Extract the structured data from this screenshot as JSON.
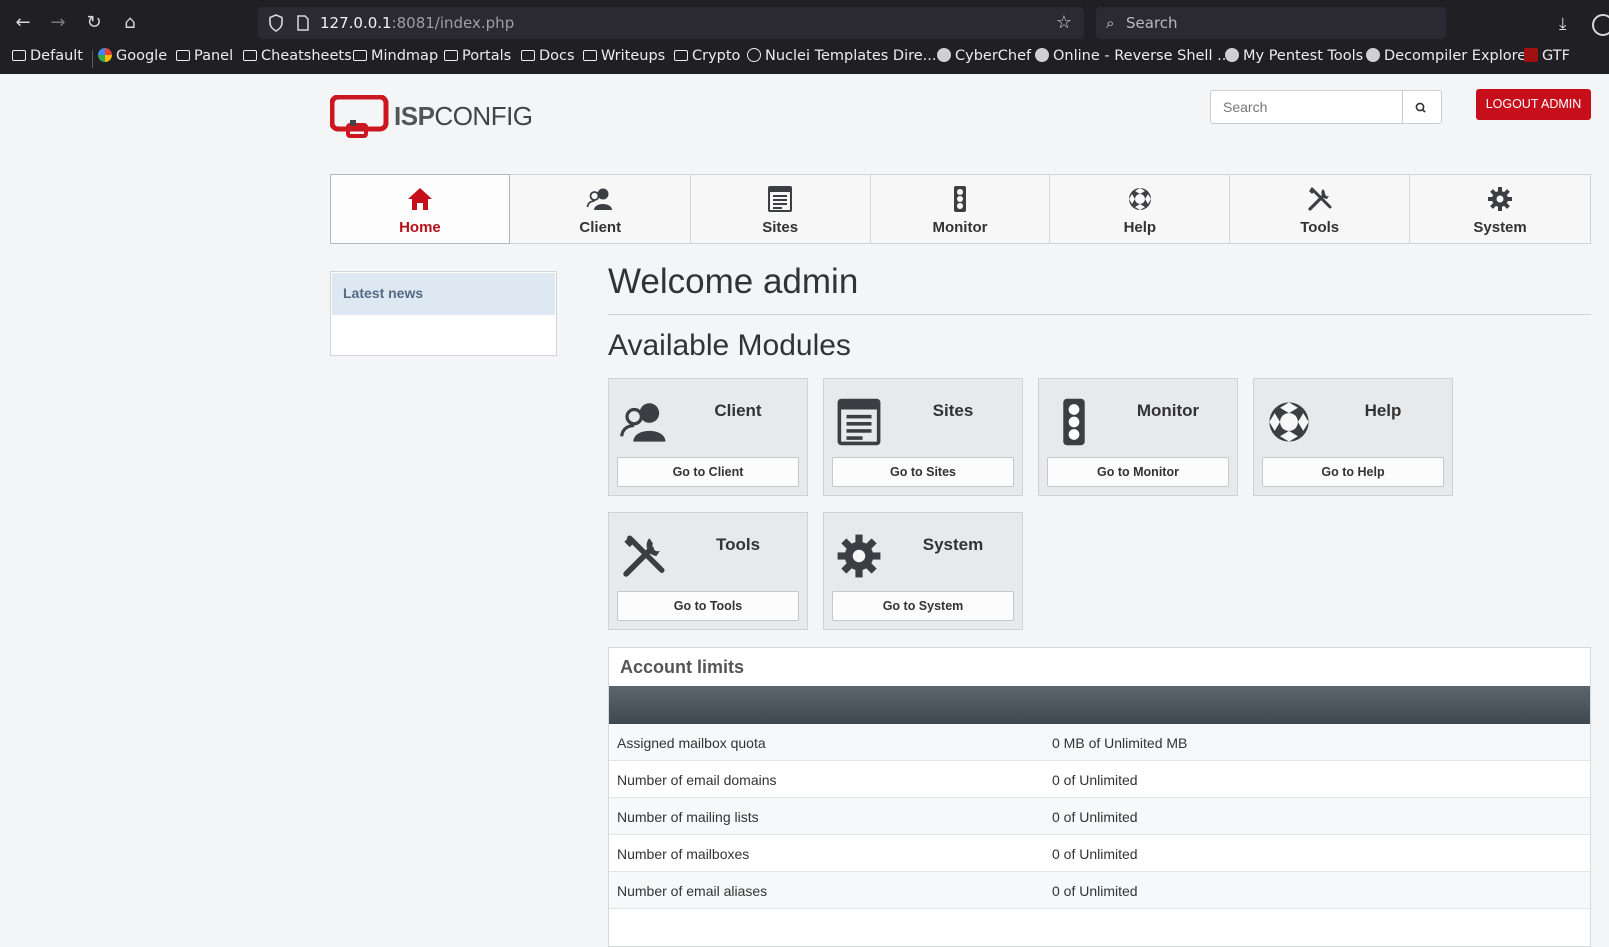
{
  "browser": {
    "url_host": "127.0.0.1",
    "url_rest": ":8081/index.php",
    "search_placeholder": "Search",
    "bookmarks": [
      {
        "label": "Default",
        "icon": "folder-icon"
      },
      {
        "label": "Google",
        "icon": "google-icon"
      },
      {
        "label": "Panel",
        "icon": "folder-icon"
      },
      {
        "label": "Cheatsheets",
        "icon": "folder-icon"
      },
      {
        "label": "Mindmap",
        "icon": "folder-icon"
      },
      {
        "label": "Portals",
        "icon": "folder-icon"
      },
      {
        "label": "Docs",
        "icon": "folder-icon"
      },
      {
        "label": "Writeups",
        "icon": "folder-icon"
      },
      {
        "label": "Crypto",
        "icon": "folder-icon"
      },
      {
        "label": "Nuclei Templates Dire...",
        "icon": "globe-icon"
      },
      {
        "label": "CyberChef",
        "icon": "chef-icon"
      },
      {
        "label": "Online - Reverse Shell ...",
        "icon": "skull-icon"
      },
      {
        "label": "My Pentest Tools",
        "icon": "shield-icon"
      },
      {
        "label": "Decompiler Explorer",
        "icon": "dogbolt-icon"
      },
      {
        "label": "GTF",
        "icon": "gtfo-icon"
      }
    ]
  },
  "header": {
    "logo_bold": "ISP",
    "logo_rest": "CONFIG",
    "search_placeholder": "Search",
    "logout_label": "LOGOUT ADMIN"
  },
  "tabs": [
    {
      "label": "Home",
      "icon": "home-icon",
      "active": true
    },
    {
      "label": "Client",
      "icon": "client-icon"
    },
    {
      "label": "Sites",
      "icon": "sites-icon"
    },
    {
      "label": "Monitor",
      "icon": "monitor-icon"
    },
    {
      "label": "Help",
      "icon": "help-icon"
    },
    {
      "label": "Tools",
      "icon": "tools-icon"
    },
    {
      "label": "System",
      "icon": "system-icon"
    }
  ],
  "sidebar": {
    "news_title": "Latest news"
  },
  "main": {
    "welcome": "Welcome admin",
    "modules_title": "Available Modules",
    "modules": [
      {
        "name": "Client",
        "button": "Go to Client",
        "icon": "client-icon"
      },
      {
        "name": "Sites",
        "button": "Go to Sites",
        "icon": "sites-icon"
      },
      {
        "name": "Monitor",
        "button": "Go to Monitor",
        "icon": "monitor-icon"
      },
      {
        "name": "Help",
        "button": "Go to Help",
        "icon": "help-icon"
      },
      {
        "name": "Tools",
        "button": "Go to Tools",
        "icon": "tools-icon"
      },
      {
        "name": "System",
        "button": "Go to System",
        "icon": "system-icon"
      }
    ],
    "limits_title": "Account limits",
    "limits": [
      {
        "name": "Assigned mailbox quota",
        "value": "0 MB of Unlimited MB"
      },
      {
        "name": "Number of email domains",
        "value": "0 of Unlimited"
      },
      {
        "name": "Number of mailing lists",
        "value": "0 of Unlimited"
      },
      {
        "name": "Number of mailboxes",
        "value": "0 of Unlimited"
      },
      {
        "name": "Number of email aliases",
        "value": "0 of Unlimited"
      }
    ]
  },
  "colors": {
    "accent_red": "#c70f1b",
    "icon_dark": "#3b3f44"
  }
}
